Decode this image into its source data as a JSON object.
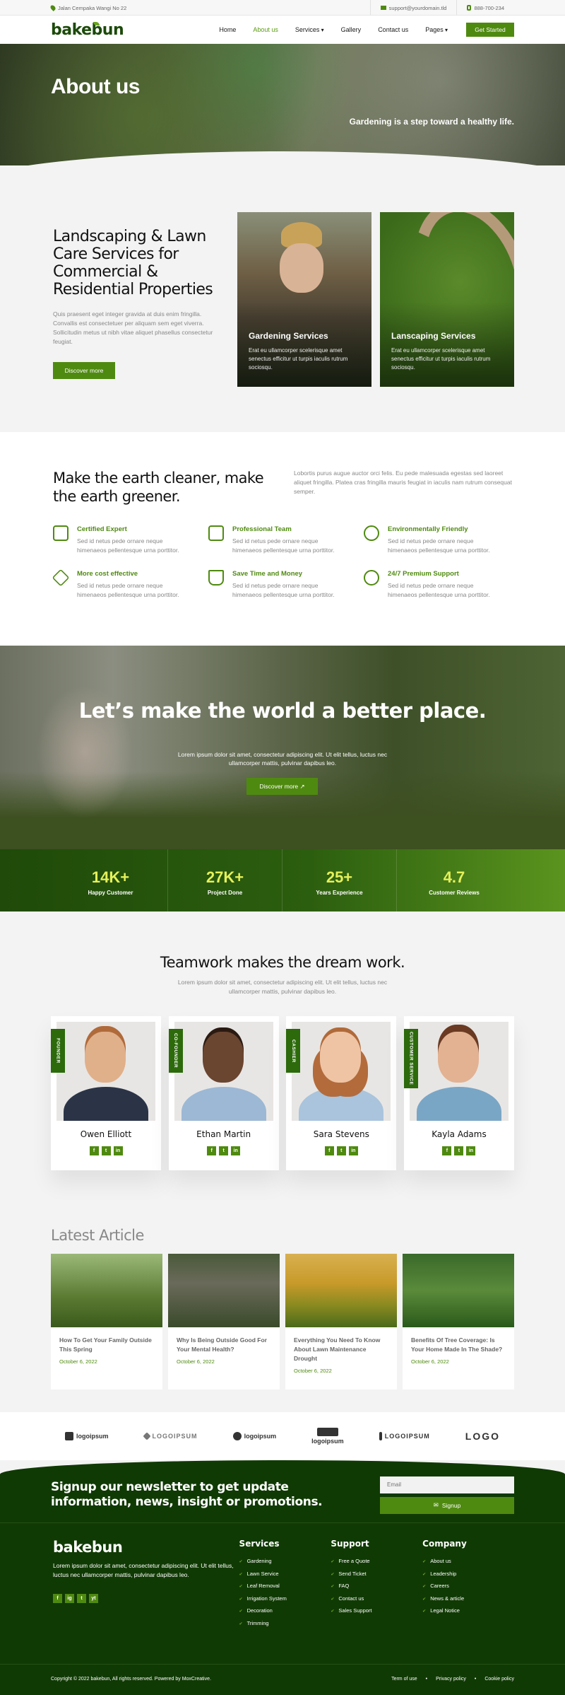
{
  "topbar": {
    "address": "Jalan Cempaka Wangi No 22",
    "email": "support@yourdomain.tld",
    "phone": "888-700-234"
  },
  "nav": {
    "logo": "bakebun",
    "items": [
      "Home",
      "About us",
      "Services",
      "Gallery",
      "Contact us",
      "Pages"
    ],
    "cta": "Get Started"
  },
  "hero": {
    "title": "About us",
    "tagline": "Gardening is a step toward a healthy life."
  },
  "services": {
    "title": "Landscaping & Lawn Care Services for Commercial & Residential Properties",
    "desc": "Quis praesent eget integer gravida at duis enim fringilla. Convallis est consectetuer per aliquam sem eget viverra. Sollicitudin metus ut nibh vitae aliquet phasellus consectetur feugiat.",
    "button": "Discover more",
    "cards": [
      {
        "title": "Gardening Services",
        "desc": "Erat eu ullamcorper scelerisque amet senectus efficitur ut turpis iaculis rutrum sociosqu."
      },
      {
        "title": "Lanscaping Services",
        "desc": "Erat eu ullamcorper scelerisque amet senectus efficitur ut turpis iaculis rutrum sociosqu."
      }
    ]
  },
  "features": {
    "title": "Make the earth cleaner, make the earth greener.",
    "desc": "Lobortis purus augue auctor orci felis. Eu pede malesuada egestas sed laoreet aliquet fringilla. Platea cras fringilla mauris feugiat in iaculis nam rutrum consequat semper.",
    "items": [
      {
        "title": "Certified Expert",
        "desc": "Sed id netus pede ornare neque himenaeos pellentesque urna porttitor."
      },
      {
        "title": "Professional Team",
        "desc": "Sed id netus pede ornare neque himenaeos pellentesque urna porttitor."
      },
      {
        "title": "Environmentally Friendly",
        "desc": "Sed id netus pede ornare neque himenaeos pellentesque urna porttitor."
      },
      {
        "title": "More cost effective",
        "desc": "Sed id netus pede ornare neque himenaeos pellentesque urna porttitor."
      },
      {
        "title": "Save Time and Money",
        "desc": "Sed id netus pede ornare neque himenaeos pellentesque urna porttitor."
      },
      {
        "title": "24/7 Premium Support",
        "desc": "Sed id netus pede ornare neque himenaeos pellentesque urna porttitor."
      }
    ]
  },
  "cta": {
    "title": "Let’s make the world a better place.",
    "desc": "Lorem ipsum dolor sit amet, consectetur adipiscing elit. Ut elit tellus, luctus nec ullamcorper mattis, pulvinar dapibus leo.",
    "button": "Discover more ↗"
  },
  "stats": [
    {
      "num": "14K+",
      "label": "Happy Customer"
    },
    {
      "num": "27K+",
      "label": "Project Done"
    },
    {
      "num": "25+",
      "label": "Years Experience"
    },
    {
      "num": "4.7",
      "label": "Customer Reviews"
    }
  ],
  "team": {
    "title": "Teamwork makes the dream work.",
    "desc": "Lorem ipsum dolor sit amet, consectetur adipiscing elit. Ut elit tellus, luctus nec ullamcorper mattis, pulvinar dapibus leo.",
    "members": [
      {
        "name": "Owen Elliott",
        "role": "FOUNDER"
      },
      {
        "name": "Ethan Martin",
        "role": "CO-FOUNDER"
      },
      {
        "name": "Sara Stevens",
        "role": "CASHIER"
      },
      {
        "name": "Kayla Adams",
        "role": "CUSTOMER SERVICE"
      }
    ],
    "social": [
      "f",
      "t",
      "in"
    ]
  },
  "articles": {
    "title": "Latest Article",
    "items": [
      {
        "title": "How To Get Your Family Outside This Spring",
        "date": "October 6, 2022"
      },
      {
        "title": "Why Is Being Outside Good For Your Mental Health?",
        "date": "October 6, 2022"
      },
      {
        "title": "Everything You Need To Know About Lawn Maintenance Drought",
        "date": "October 6, 2022"
      },
      {
        "title": "Benefits Of Tree Coverage: Is Your Home Made In The Shade?",
        "date": "October 6, 2022"
      }
    ]
  },
  "logos": [
    "logoipsum",
    "LOGOIPSUM",
    "logoipsum",
    "logoipsum",
    "LOGOIPSUM",
    "LOGO"
  ],
  "newsletter": {
    "title": "Signup our newsletter to get update information, news, insight or promotions.",
    "placeholder": "Email",
    "button": "Signup"
  },
  "footer": {
    "logo": "bakebun",
    "desc": "Lorem ipsum dolor sit amet, consectetur adipiscing elit. Ut elit tellus, luctus nec ullamcorper mattis, pulvinar dapibus leo.",
    "social": [
      "f",
      "ig",
      "t",
      "yt"
    ],
    "cols": [
      {
        "title": "Services",
        "items": [
          "Gardening",
          "Lawn Service",
          "Leaf Removal",
          "Irrigation System",
          "Decoration",
          "Trimming"
        ]
      },
      {
        "title": "Support",
        "items": [
          "Free a Quote",
          "Send Ticket",
          "FAQ",
          "Contact us",
          "Sales Support"
        ]
      },
      {
        "title": "Company",
        "items": [
          "About us",
          "Leadership",
          "Careers",
          "News & article",
          "Legal Notice"
        ]
      }
    ],
    "copyright": "Copyright © 2022 bakebun, All rights reserved. Powered by MoxCreative.",
    "links": [
      "Term of use",
      "Privacy policy",
      "Cookie policy"
    ]
  }
}
